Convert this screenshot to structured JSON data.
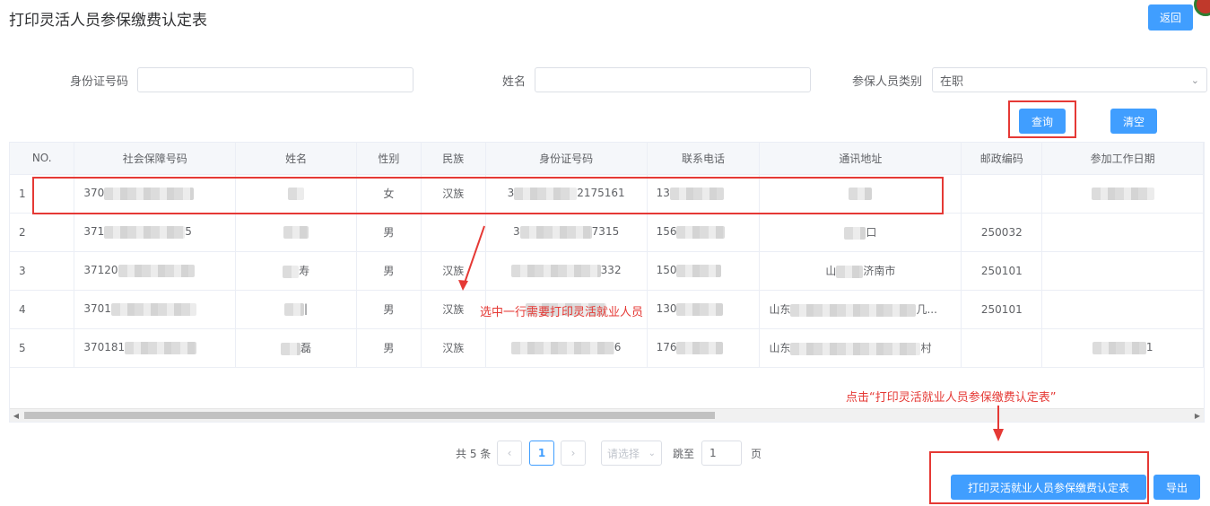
{
  "page": {
    "title": "打印灵活人员参保缴费认定表",
    "back_label": "返回"
  },
  "search": {
    "id_label": "身份证号码",
    "id_value": "",
    "name_label": "姓名",
    "name_value": "",
    "type_label": "参保人员类别",
    "type_value": "在职",
    "query_label": "查询",
    "clear_label": "清空"
  },
  "table": {
    "columns": [
      "NO.",
      "社会保障号码",
      "姓名",
      "性别",
      "民族",
      "身份证号码",
      "联系电话",
      "通讯地址",
      "邮政编码",
      "参加工作日期"
    ],
    "rows": [
      {
        "no": "1",
        "ssn": "370",
        "name": "",
        "gender": "女",
        "ethnic": "汉族",
        "idcard": "3",
        "idcard_tail": "2175161",
        "phone": "13",
        "address": "",
        "zip": "",
        "workdate": ""
      },
      {
        "no": "2",
        "ssn": "371",
        "ssn_tail": "5",
        "name": "",
        "gender": "男",
        "ethnic": "",
        "idcard": "3",
        "idcard_tail": "7315",
        "phone": "156",
        "address": "",
        "address_tail": "口",
        "zip": "250032",
        "workdate": ""
      },
      {
        "no": "3",
        "ssn": "37120",
        "name": "",
        "name_tail": "寿",
        "gender": "男",
        "ethnic": "汉族",
        "idcard": "",
        "idcard_tail": "332",
        "phone": "150",
        "address": "山",
        "address_tail": "济南市",
        "zip": "250101",
        "workdate": ""
      },
      {
        "no": "4",
        "ssn": "3701",
        "name": "",
        "name_tail": "|",
        "gender": "男",
        "ethnic": "汉族",
        "idcard": "",
        "idcard_tail": "",
        "phone": "130",
        "address": "山东",
        "address_tail": "几...",
        "zip": "250101",
        "workdate": ""
      },
      {
        "no": "5",
        "ssn": "370181",
        "name": "",
        "name_tail": "磊",
        "gender": "男",
        "ethnic": "汉族",
        "idcard": "",
        "idcard_tail": "6",
        "phone": "176",
        "address": "山东",
        "address_tail": "村",
        "zip": "",
        "workdate": "1"
      }
    ]
  },
  "annotations": {
    "select_row": "选中一行需要打印灵活就业人员",
    "click_print": "点击“打印灵活就业人员参保缴费认定表”"
  },
  "pagination": {
    "total": "共 5 条",
    "prev": "‹",
    "current": "1",
    "next": "›",
    "size_placeholder": "请选择",
    "goto_label": "跳至",
    "goto_value": "1",
    "page_suffix": "页"
  },
  "actions": {
    "print_label": "打印灵活就业人员参保缴费认定表",
    "export_label": "导出"
  },
  "colors": {
    "primary": "#409eff",
    "annotation": "#e53935"
  }
}
